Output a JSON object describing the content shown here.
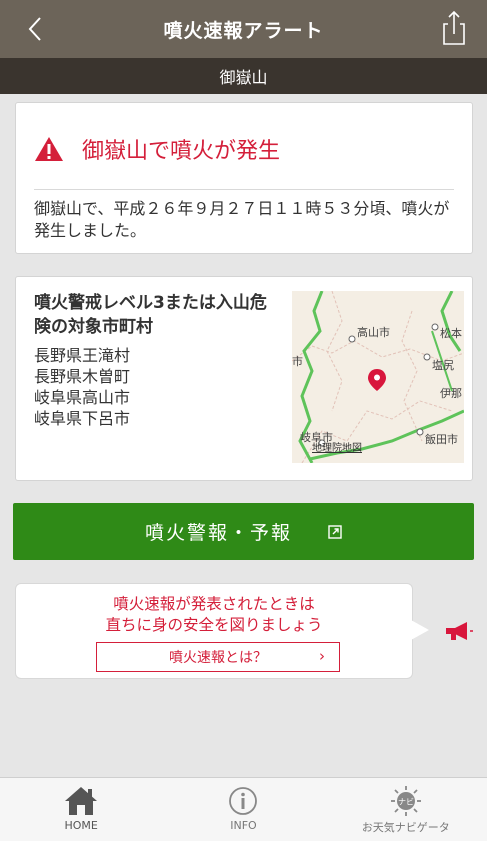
{
  "header": {
    "title": "噴火速報アラート",
    "back_icon": "chevron-left-icon",
    "share_icon": "share-icon"
  },
  "subheader": {
    "volcano": "御嶽山"
  },
  "alert": {
    "icon": "warning-triangle-icon",
    "title": "御嶽山で噴火が発生",
    "body": "御嶽山で、平成２６年９月２７日１１時５３分頃、噴火が発生しました。",
    "color": "#d41f3a"
  },
  "level": {
    "title": "噴火警戒レベル3または入山危険の対象市町村",
    "towns": [
      "長野県王滝村",
      "長野県木曽町",
      "岐阜県高山市",
      "岐阜県下呂市"
    ]
  },
  "map": {
    "labels": [
      "高山市",
      "松本",
      "塩尻",
      "伊那",
      "飯田市",
      "岐阜市",
      "市"
    ],
    "credit": "地理院地図",
    "pin_color": "#d8163c"
  },
  "forecast_button": {
    "label": "噴火警報・予報",
    "icon": "external-link-icon",
    "color": "#2f8a17"
  },
  "notice": {
    "line1": "噴火速報が発表されたときは",
    "line2": "直ちに身の安全を図りましょう",
    "link": "噴火速報とは？",
    "chevron": "›",
    "icon": "megaphone-icon"
  },
  "tabbar": {
    "items": [
      {
        "label": "HOME",
        "icon": "home-icon"
      },
      {
        "label": "INFO",
        "icon": "info-icon"
      },
      {
        "label": "お天気ナビゲータ",
        "icon": "navi-sun-icon",
        "badge": "ナビ"
      }
    ]
  }
}
